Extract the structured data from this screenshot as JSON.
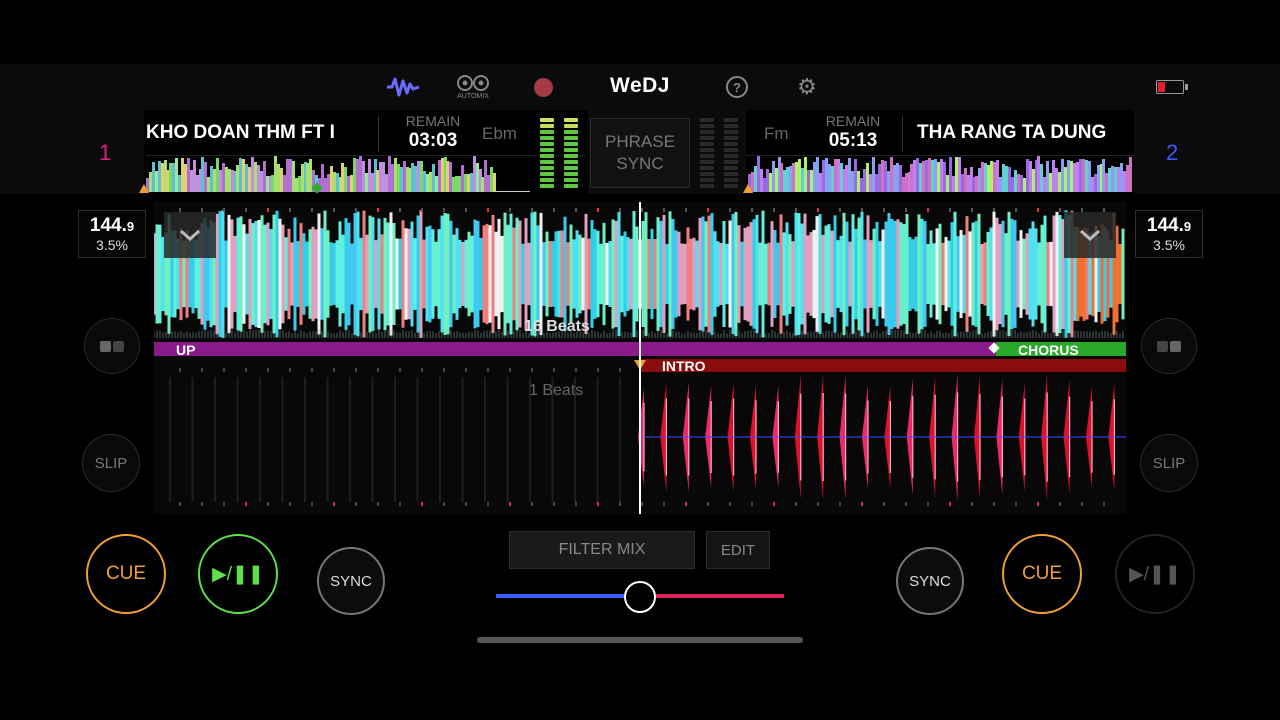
{
  "header": {
    "logo": "WeDJ",
    "automix_label": "AUTOMIX",
    "icons": [
      "waveform-icon",
      "automix-icon",
      "record-icon",
      "help-icon",
      "gear-icon",
      "battery-icon"
    ]
  },
  "deck1": {
    "number": "1",
    "title": "KHO DOAN THM FT I",
    "remain_label": "REMAIN",
    "remain_time": "03:03",
    "key": "Ebm",
    "bpm_main": "144.",
    "bpm_decimal": "9",
    "pitch": "3.5%",
    "cue_label": "CUE",
    "play_label": "▶/❚❚",
    "sync_label": "SYNC",
    "slip_label": "SLIP",
    "color": "#e0207a"
  },
  "deck2": {
    "number": "2",
    "title": "THA RANG TA DUNG",
    "remain_label": "REMAIN",
    "remain_time": "05:13",
    "key": "Fm",
    "bpm_main": "144.",
    "bpm_decimal": "9",
    "pitch": "3.5%",
    "cue_label": "CUE",
    "play_label": "▶/❚❚",
    "sync_label": "SYNC",
    "slip_label": "SLIP",
    "color": "#3a5cff"
  },
  "center": {
    "phrase_line1": "PHRASE",
    "phrase_line2": "SYNC",
    "filter_mix": "FILTER MIX",
    "edit": "EDIT",
    "crossfader": 0.5
  },
  "waveform": {
    "beats_top": "16 Beats",
    "beats_bottom": "1 Beats",
    "phrase_up": "UP",
    "phrase_chorus": "CHORUS",
    "phrase_intro": "INTRO"
  },
  "colors": {
    "cue": "#f0a030",
    "play_active": "#5ee04a",
    "phrase_purple": "#8a1a8a",
    "phrase_green": "#2aa82a",
    "phrase_red": "#8a0c0c"
  }
}
